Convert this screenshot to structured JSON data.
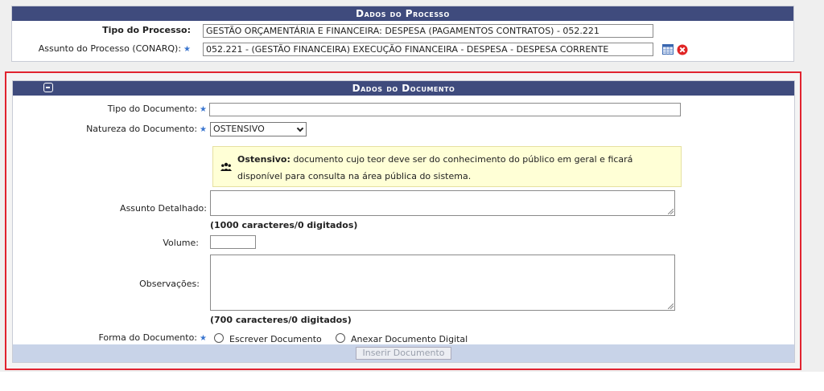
{
  "process": {
    "title": "Dados do Processo",
    "tipo_label": "Tipo do Processo:",
    "tipo_value": "GESTÃO ORÇAMENTÁRIA E FINANCEIRA: DESPESA (PAGAMENTOS CONTRATOS) - 052.221",
    "assunto_label": "Assunto do Processo (CONARQ):",
    "required_mark": "★",
    "assunto_value": "052.221 - (GESTÃO FINANCEIRA) EXECUÇÃO FINANCEIRA - DESPESA - DESPESA CORRENTE"
  },
  "document": {
    "title": "Dados do Documento",
    "tipo_label": "Tipo do Documento:",
    "tipo_value": "",
    "natureza_label": "Natureza do Documento:",
    "natureza_value": "OSTENSIVO",
    "notice_title": "Ostensivo:",
    "notice_text": " documento cujo teor deve ser do conhecimento do público em geral e ficará disponível para consulta na área pública do sistema.",
    "assunto_label": "Assunto Detalhado:",
    "assunto_counter": "(1000 caracteres/0 digitados)",
    "volume_label": "Volume:",
    "obs_label": "Observações:",
    "obs_counter": "(700 caracteres/0 digitados)",
    "forma_label": "Forma do Documento:",
    "forma_opt1": "Escrever Documento",
    "forma_opt2": "Anexar Documento Digital",
    "submit_label": "Inserir Documento"
  },
  "icons": {
    "table": "table-icon",
    "remove": "remove-icon",
    "users": "users-icon",
    "collapse": "collapse-icon"
  },
  "colors": {
    "header_bar": "#3f4b7d",
    "highlight_border": "#e1232f",
    "required_star": "#3b76cf",
    "notice_bg": "#ffffd6",
    "footer_bar": "#c8d3e8"
  }
}
